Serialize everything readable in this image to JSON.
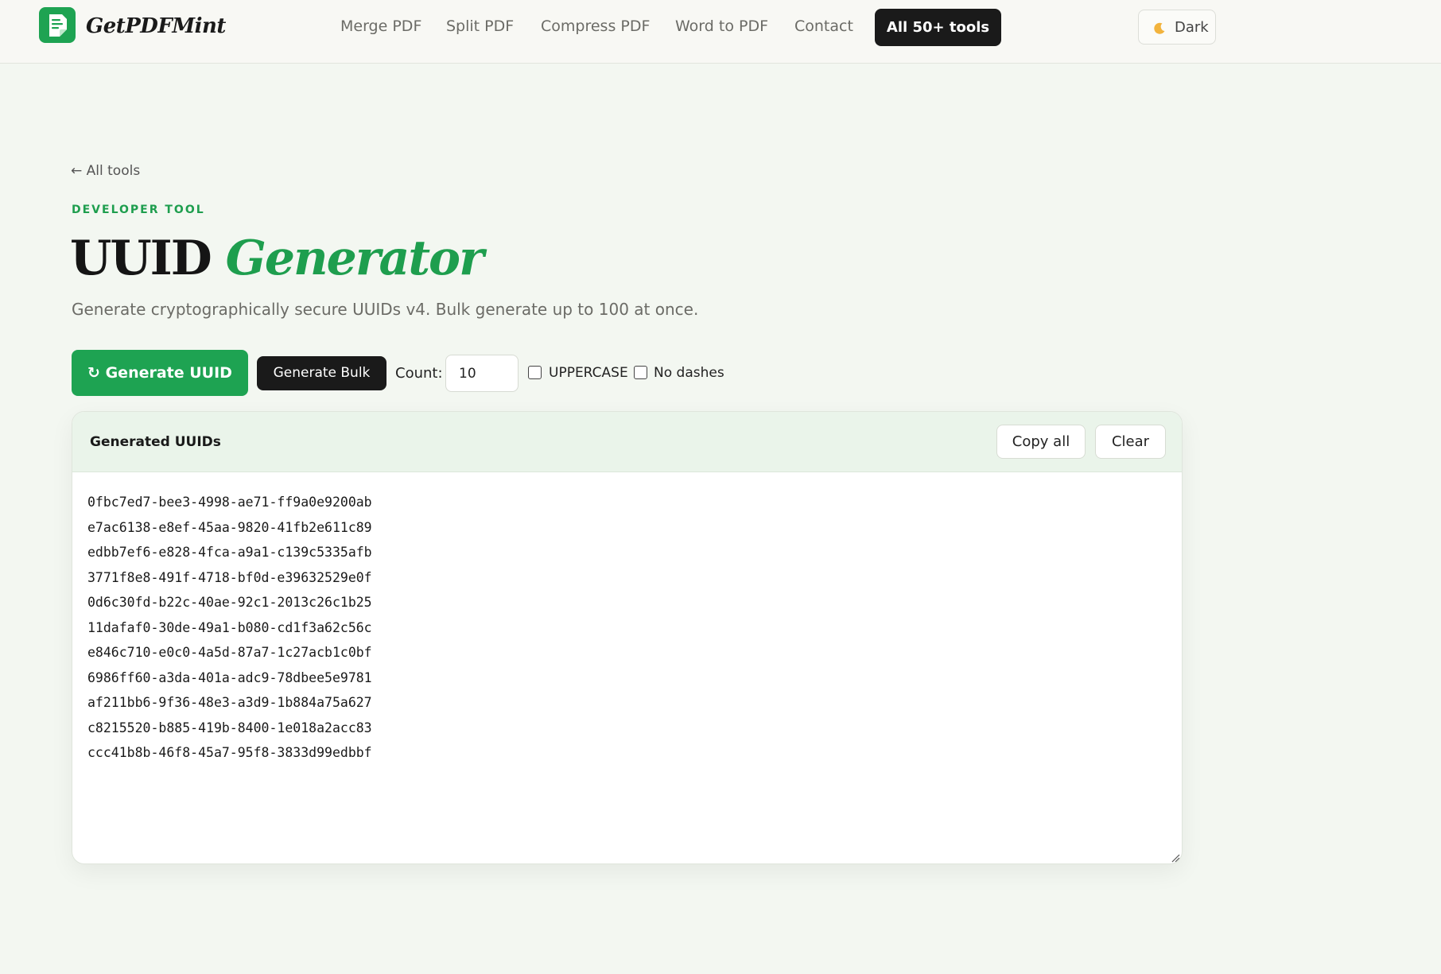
{
  "header": {
    "brand": "GetPDFMint",
    "nav": [
      "Merge PDF",
      "Split PDF",
      "Compress PDF",
      "Word to PDF",
      "Contact"
    ],
    "all_tools_label": "All 50+ tools",
    "theme_label": "Dark"
  },
  "main": {
    "back_link": "← All tools",
    "eyebrow": "DEVELOPER TOOL",
    "title_main": "UUID",
    "title_accent": "Generator",
    "subtitle": "Generate cryptographically secure UUIDs v4. Bulk generate up to 100 at once."
  },
  "controls": {
    "generate_label": "↻ Generate UUID",
    "bulk_label": "Generate Bulk",
    "count_label": "Count:",
    "count_value": "10",
    "uppercase_label": "UPPERCASE",
    "uppercase_checked": false,
    "no_dashes_label": "No dashes",
    "no_dashes_checked": false
  },
  "panel": {
    "title": "Generated UUIDs",
    "copy_label": "Copy all",
    "clear_label": "Clear",
    "uuids": [
      "0fbc7ed7-bee3-4998-ae71-ff9a0e9200ab",
      "e7ac6138-e8ef-45aa-9820-41fb2e611c89",
      "edbb7ef6-e828-4fca-a9a1-c139c5335afb",
      "3771f8e8-491f-4718-bf0d-e39632529e0f",
      "0d6c30fd-b22c-40ae-92c1-2013c26c1b25",
      "11dafaf0-30de-49a1-b080-cd1f3a62c56c",
      "e846c710-e0c0-4a5d-87a7-1c27acb1c0bf",
      "6986ff60-a3da-401a-adc9-78dbee5e9781",
      "af211bb6-9f36-48e3-a3d9-1b884a75a627",
      "c8215520-b885-419b-8400-1e018a2acc83",
      "ccc41b8b-46f8-45a7-95f8-3833d99edbbf"
    ]
  },
  "colors": {
    "accent": "#1ea352",
    "dark": "#1a1a1a",
    "background": "#f3f7f1"
  },
  "icons": {
    "logo": "document-check-icon",
    "theme": "moon-icon",
    "generate": "refresh-icon"
  }
}
